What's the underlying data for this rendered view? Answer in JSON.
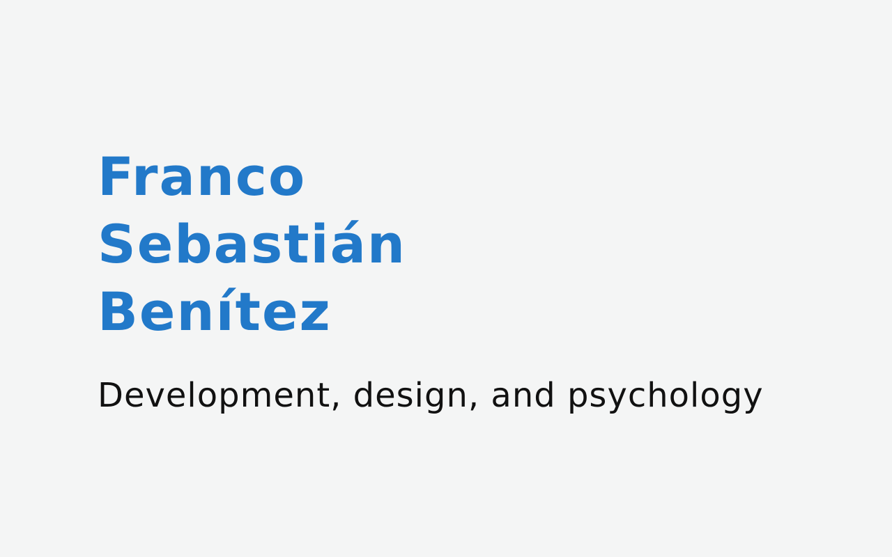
{
  "hero": {
    "name_lines": [
      "Franco",
      "Sebastián",
      "Benítez"
    ],
    "tagline": "Development, design, and psychology"
  },
  "colors": {
    "background": "#f4f5f5",
    "name": "#2279c9",
    "tagline": "#111111"
  }
}
